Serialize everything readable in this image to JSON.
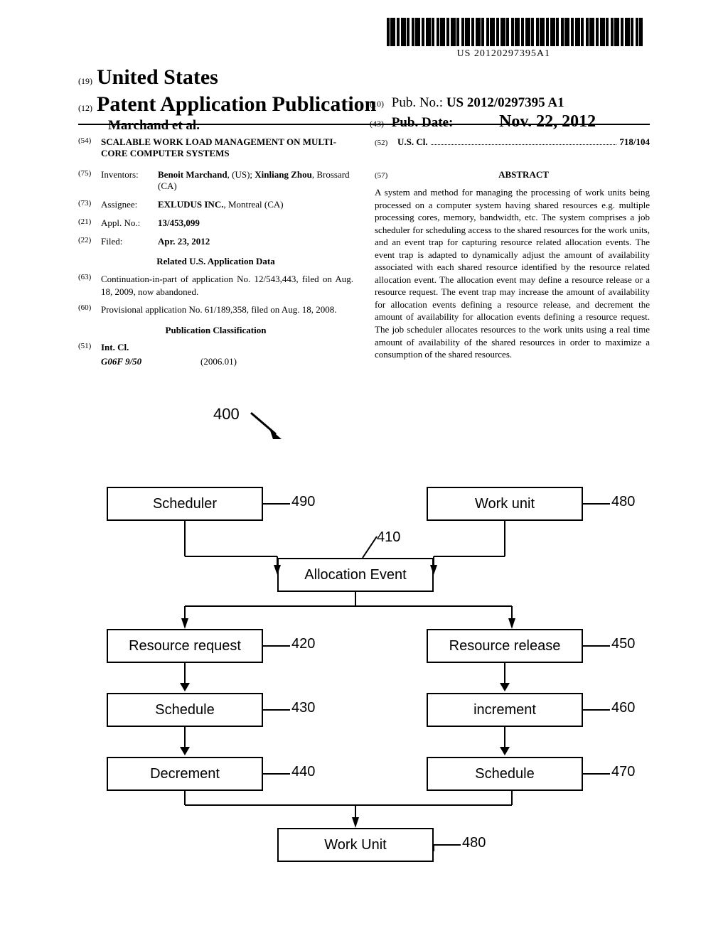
{
  "barcode_number": "US 20120297395A1",
  "header": {
    "prefix_19": "(19)",
    "country": "United States",
    "prefix_12": "(12)",
    "pub_type": "Patent Application Publication",
    "authors": "Marchand et al.",
    "prefix_10": "(10)",
    "pub_no_label": "Pub. No.:",
    "pub_no": "US 2012/0297395 A1",
    "prefix_43": "(43)",
    "pub_date_label": "Pub. Date:",
    "pub_date": "Nov. 22, 2012"
  },
  "left_column": {
    "title_num": "(54)",
    "title": "SCALABLE WORK LOAD MANAGEMENT ON MULTI-CORE COMPUTER SYSTEMS",
    "inventors_num": "(75)",
    "inventors_label": "Inventors:",
    "inventors_html_1": "Benoit Marchand",
    "inventors_loc_1": ", (US); ",
    "inventors_html_2": "Xinliang Zhou",
    "inventors_loc_2": ", Brossard (CA)",
    "assignee_num": "(73)",
    "assignee_label": "Assignee:",
    "assignee_name": "EXLUDUS INC.",
    "assignee_loc": ", Montreal (CA)",
    "appl_num": "(21)",
    "appl_label": "Appl. No.:",
    "appl_value": "13/453,099",
    "filed_num": "(22)",
    "filed_label": "Filed:",
    "filed_value": "Apr. 23, 2012",
    "related_heading": "Related U.S. Application Data",
    "cont_num": "(63)",
    "cont_text": "Continuation-in-part of application No. 12/543,443, filed on Aug. 18, 2009, now abandoned.",
    "prov_num": "(60)",
    "prov_text": "Provisional application No. 61/189,358, filed on Aug. 18, 2008.",
    "classification_heading": "Publication Classification",
    "int_cl_num": "(51)",
    "int_cl_label": "Int. Cl.",
    "int_cl_code": "G06F 9/50",
    "int_cl_year": "(2006.01)"
  },
  "right_column": {
    "us_cl_num": "(52)",
    "us_cl_label": "U.S. Cl.",
    "us_cl_value": "718/104",
    "abstract_num": "(57)",
    "abstract_heading": "ABSTRACT",
    "abstract_text": "A system and method for managing the processing of work units being processed on a computer system having shared resources e.g. multiple processing cores, memory, bandwidth, etc. The system comprises a job scheduler for scheduling access to the shared resources for the work units, and an event trap for capturing resource related allocation events. The event trap is adapted to dynamically adjust the amount of availability associated with each shared resource identified by the resource related allocation event. The allocation event may define a resource release or a resource request. The event trap may increase the amount of availability for allocation events defining a resource release, and decrement the amount of availability for allocation events defining a resource request. The job scheduler allocates resources to the work units using a real time amount of availability of the shared resources in order to maximize a consumption of the shared resources."
  },
  "figure": {
    "number": "400",
    "boxes": {
      "scheduler": "Scheduler",
      "work_unit_top": "Work unit",
      "allocation_event": "Allocation Event",
      "resource_request": "Resource request",
      "resource_release": "Resource release",
      "schedule_left": "Schedule",
      "increment": "increment",
      "decrement": "Decrement",
      "schedule_right": "Schedule",
      "work_unit_bottom": "Work Unit"
    },
    "labels": {
      "490": "490",
      "480_top": "480",
      "410": "410",
      "420": "420",
      "450": "450",
      "430": "430",
      "460": "460",
      "440": "440",
      "470": "470",
      "480_bottom": "480"
    }
  }
}
